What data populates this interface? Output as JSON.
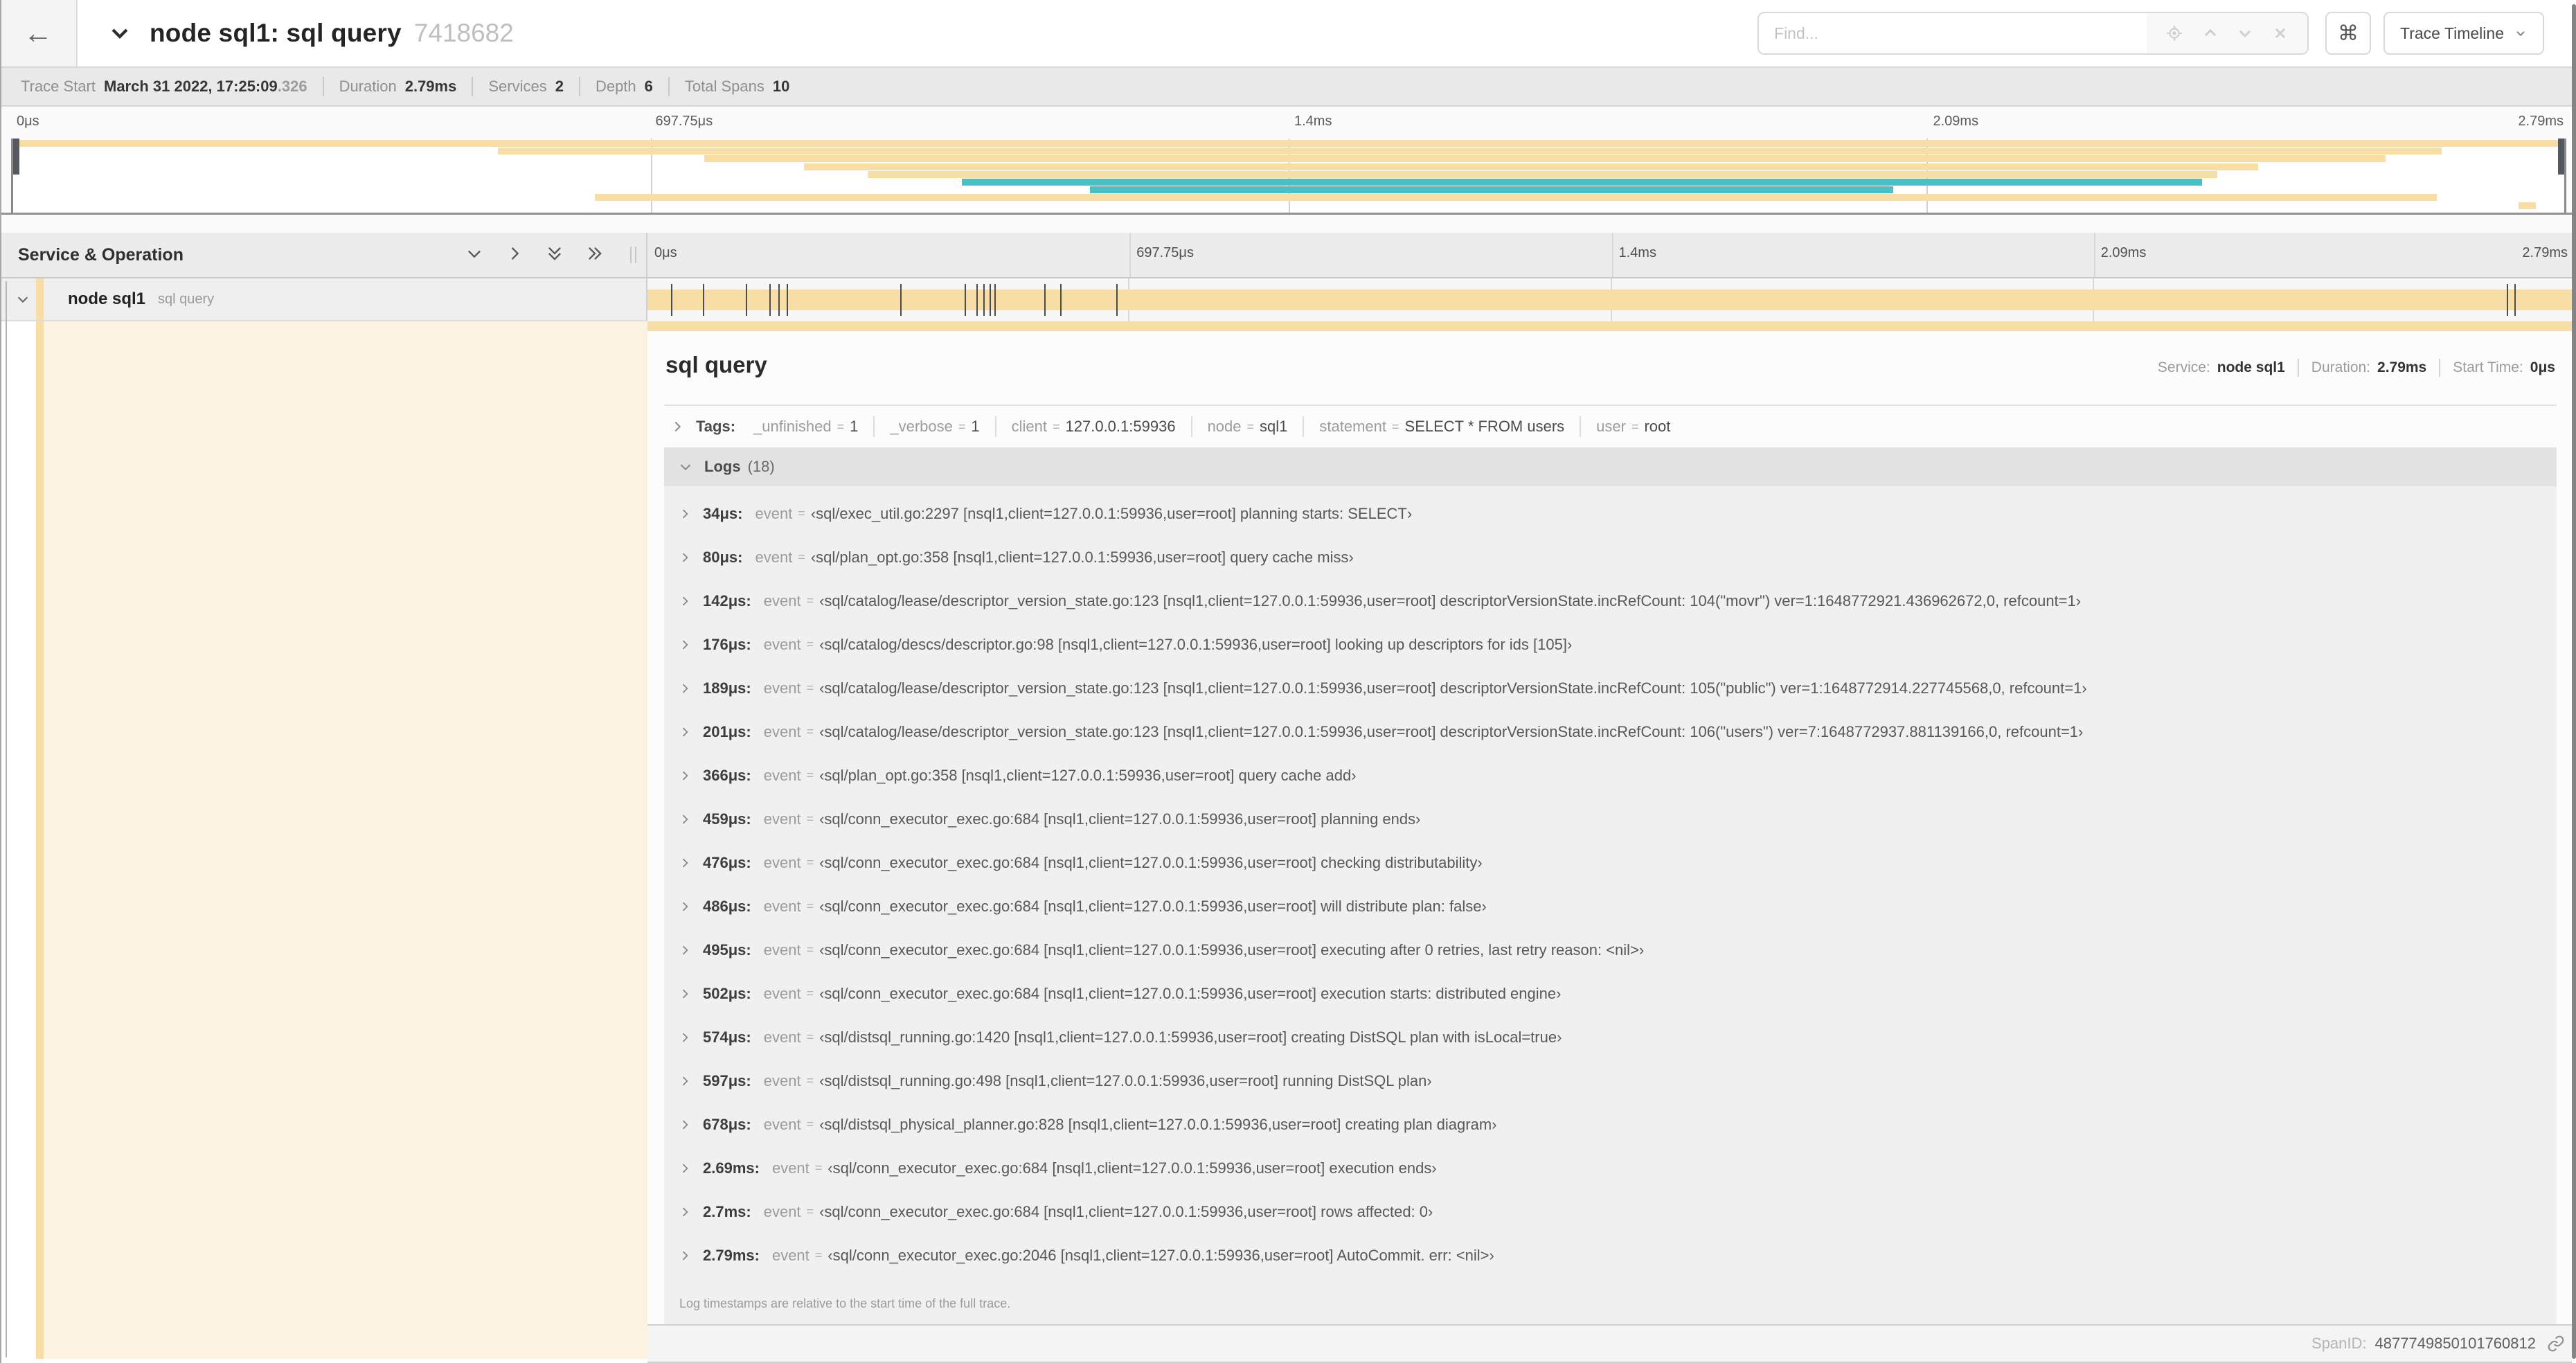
{
  "colors": {
    "span_tan": "#f8dda4",
    "span_teal": "#48c0c6",
    "detail_cream": "#fbf2e0"
  },
  "topnav": {
    "back_icon": "arrow-left",
    "title_collapse_icon": "chevron-down",
    "title": "node sql1: sql query",
    "trace_id_short": "7418682",
    "find": {
      "placeholder": "Find...",
      "buttons": [
        "locate-icon",
        "chevron-up-icon",
        "chevron-down-icon",
        "clear-icon"
      ]
    },
    "shortcuts_icon": "command",
    "shortcuts_glyph": "⌘",
    "view_selector": {
      "label": "Trace Timeline",
      "caret": "chevron-down"
    }
  },
  "tracebar": {
    "items": [
      {
        "label": "Trace Start",
        "value": "March 31 2022, 17:25:09",
        "suffix": ".326"
      },
      {
        "label": "Duration",
        "value": "2.79ms"
      },
      {
        "label": "Services",
        "value": "2"
      },
      {
        "label": "Depth",
        "value": "6"
      },
      {
        "label": "Total Spans",
        "value": "10"
      }
    ]
  },
  "axis": {
    "ticks": [
      {
        "label": "0μs",
        "pct": 0
      },
      {
        "label": "697.75μs",
        "pct": 25
      },
      {
        "label": "1.4ms",
        "pct": 50
      },
      {
        "label": "2.09ms",
        "pct": 75
      },
      {
        "label": "2.79ms",
        "pct": 100
      }
    ]
  },
  "minimap": {
    "bars": [
      {
        "start_pct": 0,
        "end_pct": 100,
        "color": "tan"
      },
      {
        "start_pct": 19.0,
        "end_pct": 95.2,
        "color": "tan"
      },
      {
        "start_pct": 27.1,
        "end_pct": 93.0,
        "color": "tan"
      },
      {
        "start_pct": 31.0,
        "end_pct": 88.0,
        "color": "tan"
      },
      {
        "start_pct": 33.5,
        "end_pct": 86.4,
        "color": "tan"
      },
      {
        "start_pct": 37.2,
        "end_pct": 85.8,
        "color": "teal"
      },
      {
        "start_pct": 42.2,
        "end_pct": 73.7,
        "color": "teal"
      },
      {
        "start_pct": 22.8,
        "end_pct": 95.0,
        "color": "tan"
      },
      {
        "start_pct": 98.2,
        "end_pct": 98.9,
        "color": "tan"
      }
    ]
  },
  "timeline_header": {
    "title": "Service & Operation",
    "icons": [
      "collapse-one-icon",
      "expand-one-icon",
      "collapse-all-icon",
      "expand-all-icon"
    ]
  },
  "span_row": {
    "collapse_icon": "chevron-down",
    "service": "node sql1",
    "operation": "sql query",
    "log_tick_pcts": [
      1.22,
      2.87,
      5.09,
      6.31,
      6.78,
      7.2,
      13.12,
      16.45,
      17.06,
      17.42,
      17.74,
      18.0,
      20.57,
      21.4,
      24.3,
      96.4,
      96.8,
      99.85
    ]
  },
  "detail": {
    "title": "sql query",
    "meta": [
      {
        "label": "Service:",
        "value": "node sql1"
      },
      {
        "label": "Duration:",
        "value": "2.79ms"
      },
      {
        "label": "Start Time:",
        "value": "0μs"
      }
    ],
    "tags": {
      "expander": "chevron-right",
      "label": "Tags:",
      "items": [
        {
          "key": "_unfinished",
          "value": "1"
        },
        {
          "key": "_verbose",
          "value": "1"
        },
        {
          "key": "client",
          "value": "127.0.0.1:59936"
        },
        {
          "key": "node",
          "value": "sql1"
        },
        {
          "key": "statement",
          "value": "SELECT * FROM users"
        },
        {
          "key": "user",
          "value": "root"
        }
      ]
    },
    "logs": {
      "expander": "chevron-down",
      "label": "Logs",
      "count": "(18)",
      "entry_key": "event",
      "equals": "=",
      "entries": [
        {
          "time": "34μs:",
          "value": "‹sql/exec_util.go:2297 [nsql1,client=127.0.0.1:59936,user=root] planning starts: SELECT›"
        },
        {
          "time": "80μs:",
          "value": "‹sql/plan_opt.go:358 [nsql1,client=127.0.0.1:59936,user=root] query cache miss›"
        },
        {
          "time": "142μs:",
          "value": "‹sql/catalog/lease/descriptor_version_state.go:123 [nsql1,client=127.0.0.1:59936,user=root] descriptorVersionState.incRefCount: 104(\"movr\") ver=1:1648772921.436962672,0, refcount=1›"
        },
        {
          "time": "176μs:",
          "value": "‹sql/catalog/descs/descriptor.go:98 [nsql1,client=127.0.0.1:59936,user=root] looking up descriptors for ids [105]›"
        },
        {
          "time": "189μs:",
          "value": "‹sql/catalog/lease/descriptor_version_state.go:123 [nsql1,client=127.0.0.1:59936,user=root] descriptorVersionState.incRefCount: 105(\"public\") ver=1:1648772914.227745568,0, refcount=1›"
        },
        {
          "time": "201μs:",
          "value": "‹sql/catalog/lease/descriptor_version_state.go:123 [nsql1,client=127.0.0.1:59936,user=root] descriptorVersionState.incRefCount: 106(\"users\") ver=7:1648772937.881139166,0, refcount=1›"
        },
        {
          "time": "366μs:",
          "value": "‹sql/plan_opt.go:358 [nsql1,client=127.0.0.1:59936,user=root] query cache add›"
        },
        {
          "time": "459μs:",
          "value": "‹sql/conn_executor_exec.go:684 [nsql1,client=127.0.0.1:59936,user=root] planning ends›"
        },
        {
          "time": "476μs:",
          "value": "‹sql/conn_executor_exec.go:684 [nsql1,client=127.0.0.1:59936,user=root] checking distributability›"
        },
        {
          "time": "486μs:",
          "value": "‹sql/conn_executor_exec.go:684 [nsql1,client=127.0.0.1:59936,user=root] will distribute plan: false›"
        },
        {
          "time": "495μs:",
          "value": "‹sql/conn_executor_exec.go:684 [nsql1,client=127.0.0.1:59936,user=root] executing after 0 retries, last retry reason: <nil>›"
        },
        {
          "time": "502μs:",
          "value": "‹sql/conn_executor_exec.go:684 [nsql1,client=127.0.0.1:59936,user=root] execution starts: distributed engine›"
        },
        {
          "time": "574μs:",
          "value": "‹sql/distsql_running.go:1420 [nsql1,client=127.0.0.1:59936,user=root] creating DistSQL plan with isLocal=true›"
        },
        {
          "time": "597μs:",
          "value": "‹sql/distsql_running.go:498 [nsql1,client=127.0.0.1:59936,user=root] running DistSQL plan›"
        },
        {
          "time": "678μs:",
          "value": "‹sql/distsql_physical_planner.go:828 [nsql1,client=127.0.0.1:59936,user=root] creating plan diagram›"
        },
        {
          "time": "2.69ms:",
          "value": "‹sql/conn_executor_exec.go:684 [nsql1,client=127.0.0.1:59936,user=root] execution ends›"
        },
        {
          "time": "2.7ms:",
          "value": "‹sql/conn_executor_exec.go:684 [nsql1,client=127.0.0.1:59936,user=root] rows affected: 0›"
        },
        {
          "time": "2.79ms:",
          "value": "‹sql/conn_executor_exec.go:2046 [nsql1,client=127.0.0.1:59936,user=root] AutoCommit. err: <nil>›"
        }
      ],
      "footer": "Log timestamps are relative to the start time of the full trace."
    },
    "span_id_label": "SpanID:",
    "span_id": "4877749850101760812",
    "link_icon": "link"
  }
}
